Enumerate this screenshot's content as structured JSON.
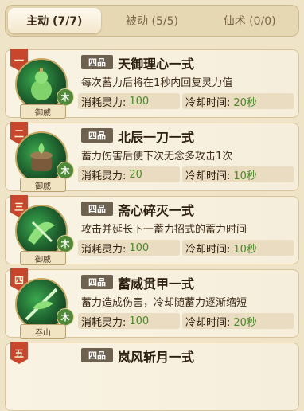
{
  "tabs": [
    {
      "label": "主动 (7/7)"
    },
    {
      "label": "被动 (5/5)"
    },
    {
      "label": "仙术 (0/0)"
    }
  ],
  "colors": {
    "ribbon": "#c8462c",
    "value": "#4a8a2a",
    "element": "#4f8a3a"
  },
  "skills": [
    {
      "rank": "一",
      "grade": "四品",
      "name": "天御理心一式",
      "desc": "每次蓄力后将在1秒内回复灵力值",
      "cost_label": "消耗灵力:",
      "cost": "100",
      "cd_label": "冷却时间:",
      "cd": "20秒",
      "element": "木",
      "school": "御戚",
      "icon": "gourd-icon"
    },
    {
      "rank": "二",
      "grade": "四品",
      "name": "北辰一刀一式",
      "desc": "蓄力伤害后使下次无念多攻击1次",
      "cost_label": "消耗灵力:",
      "cost": "20",
      "cd_label": "冷却时间:",
      "cd": "10秒",
      "element": "木",
      "school": "御戚",
      "icon": "pot-icon"
    },
    {
      "rank": "三",
      "grade": "四品",
      "name": "斋心碎灭一式",
      "desc": "攻击并延长下一蓄力招式的蓄力时间",
      "cost_label": "消耗灵力:",
      "cost": "100",
      "cd_label": "冷却时间:",
      "cd": "10秒",
      "element": "木",
      "school": "御戚",
      "icon": "blade-swirl-icon"
    },
    {
      "rank": "四",
      "grade": "四品",
      "name": "蓄威贯甲一式",
      "desc": "蓄力造成伤害，冷却随蓄力逐渐缩短",
      "cost_label": "消耗灵力:",
      "cost": "100",
      "cd_label": "冷却时间:",
      "cd": "20秒",
      "element": "木",
      "school": "吞山",
      "icon": "spear-icon"
    },
    {
      "rank": "五",
      "grade": "四品",
      "name": "岚风斩月一式"
    }
  ]
}
